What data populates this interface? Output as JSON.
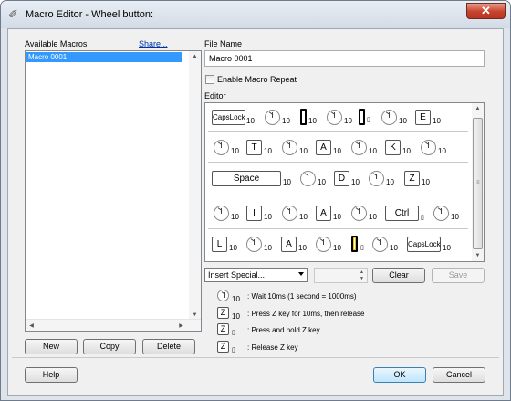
{
  "window": {
    "title": "Macro Editor - Wheel button:",
    "close_glyph": "✕"
  },
  "left": {
    "available_label": "Available Macros",
    "share_link": "Share...",
    "macros": [
      "Macro 0001"
    ],
    "buttons": {
      "new": "New",
      "copy": "Copy",
      "delete": "Delete"
    }
  },
  "right": {
    "file_name_label": "File Name",
    "file_name_value": "Macro 0001",
    "repeat_label": "Enable Macro Repeat",
    "repeat_checked": false,
    "editor_label": "Editor",
    "wait_value": "10",
    "key_labels": {
      "capslock": "CapsLock",
      "e": "E",
      "t": "T",
      "a": "A",
      "k": "K",
      "space": "Space",
      "d": "D",
      "z": "Z",
      "i": "I",
      "ctrl": "Ctrl",
      "l": "L"
    },
    "insert_special": "Insert Special...",
    "clear_button": "Clear",
    "save_button": "Save"
  },
  "legend": {
    "wait": ": Wait 10ms (1 second = 1000ms)",
    "press": ": Press Z key for 10ms, then release",
    "hold": ": Press and hold Z key",
    "release": ": Release Z key",
    "key_letter": "Z",
    "ten": "10"
  },
  "footer": {
    "help": "Help",
    "ok": "OK",
    "cancel": "Cancel"
  },
  "colors": {
    "selection": "#3399ff",
    "close_button": "#c6422c",
    "link": "#0033aa"
  },
  "icons": [
    "pencil-icon",
    "close-icon",
    "clock-icon",
    "key-down-icon",
    "key-up-icon",
    "dropdown-arrow-icon"
  ]
}
